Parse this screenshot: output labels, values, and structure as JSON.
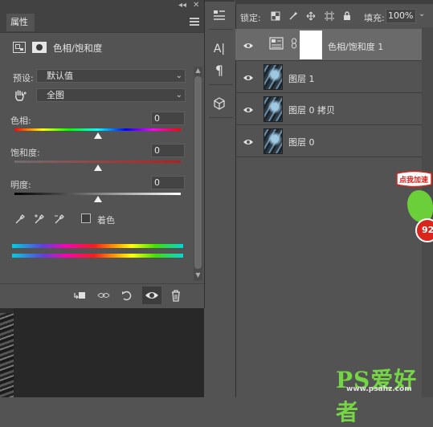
{
  "properties_panel": {
    "tab_label": "属性",
    "collapse_glyph": "◂◂",
    "close_glyph": "✕",
    "adjustment_title": "色相/饱和度",
    "preset_label": "预设:",
    "preset_value": "默认值",
    "channel_value": "全图",
    "hue": {
      "label": "色相:",
      "value": "0",
      "slider_fraction": 0.5
    },
    "saturation": {
      "label": "饱和度:",
      "value": "0",
      "slider_fraction": 0.5
    },
    "lightness": {
      "label": "明度:",
      "value": "0",
      "slider_fraction": 0.5
    },
    "colorize_label": "着色",
    "colorize_checked": false
  },
  "tool_strip": {
    "icons": [
      "properties-panel-icon",
      "character-icon",
      "paragraph-icon",
      "3d-icon"
    ],
    "char_glyph": "A|",
    "para_glyph": "¶"
  },
  "layers_panel": {
    "lock_label": "锁定:",
    "fill_label": "填充:",
    "fill_value": "100%",
    "layers": [
      {
        "name": "色相/饱和度 1",
        "type": "adjustment",
        "selected": true,
        "visible": true
      },
      {
        "name": "图层 1",
        "type": "image",
        "selected": false,
        "visible": true
      },
      {
        "name": "图层 0 拷贝",
        "type": "image",
        "selected": false,
        "visible": true
      },
      {
        "name": "图层 0",
        "type": "image",
        "selected": false,
        "visible": true
      }
    ]
  },
  "overlays": {
    "promo_text": "点我加速",
    "red_badge_text": "92",
    "watermark_main": "PS爱好者",
    "watermark_url": "www.psahz.com"
  },
  "colors": {
    "panel_bg": "#535353",
    "dark_bar": "#424242",
    "selected_row": "#6a6a6a",
    "watermark_green": "#74d645"
  }
}
